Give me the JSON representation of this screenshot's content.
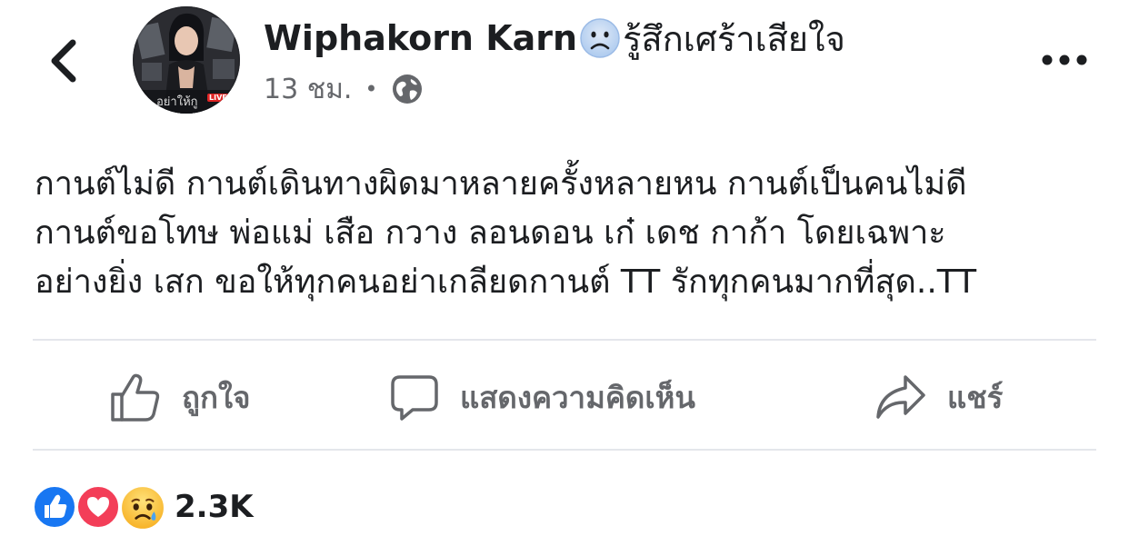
{
  "post": {
    "author": "Wiphakorn Karn",
    "feeling_text": "รู้สึกเศร้าเสียใจ",
    "time": "13 ชม.",
    "avatar_caption": "อย่าให้กู",
    "avatar_badge": "LIVE",
    "body_lines": [
      "กานต์ไม่ดี กานต์เดินทางผิดมาหลายครั้งหลายหน กานต์เป็นคนไม่ดี",
      "กานต์ขอโทษ พ่อแม่ เสือ กวาง ลอนดอน เก๋ เดช กาก้า  โดยเฉพาะ",
      "อย่างยิ่ง เสก ขอให้ทุกคนอย่าเกลียดกานต์ TT รักทุกคนมากที่สุด..TT"
    ]
  },
  "actions": {
    "like": "ถูกใจ",
    "comment": "แสดงความคิดเห็น",
    "share": "แชร์"
  },
  "reactions": {
    "count": "2.3K",
    "icons": [
      "like-reaction-icon",
      "love-reaction-icon",
      "sad-reaction-icon"
    ]
  },
  "colors": {
    "like_blue": "#1877f2",
    "love_red": "#f33e58",
    "sad_yellow": "#f7b125",
    "muted_text": "#65676b",
    "divider": "#e4e6eb"
  }
}
